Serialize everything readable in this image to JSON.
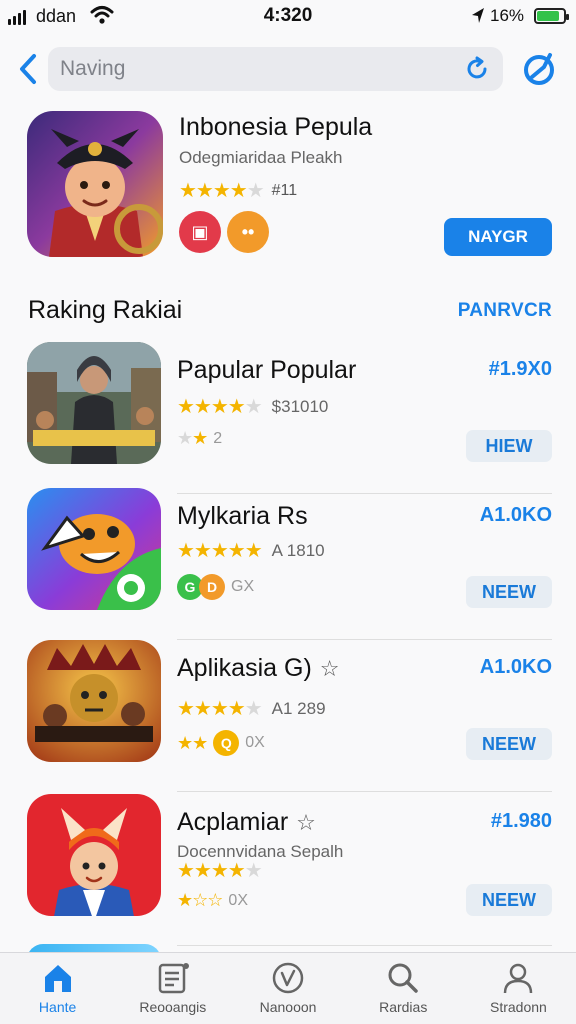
{
  "status_bar": {
    "carrier": "ddan",
    "time": "4:320",
    "battery": "16%",
    "battery_level": 0.85
  },
  "search": {
    "placeholder": "Naving"
  },
  "featured": {
    "title": "Inbonesia Pepula",
    "subtitle": "Odegmiaridaa Pleakh",
    "stars": 4.5,
    "rating_count": "#11",
    "button": "NAYGR",
    "icon": "featured-app-icon"
  },
  "section": {
    "title": "Raking Rakiai",
    "link": "PANRVCR"
  },
  "apps": [
    {
      "name": "Papular Popular",
      "price": "#1.9X0",
      "stars": 4.5,
      "rating_count": "$31010",
      "meta": "2",
      "action": "HIEW",
      "icon": "app-icon-popular"
    },
    {
      "name": "Mylkaria Rs",
      "price": "A1.0KO",
      "stars": 5,
      "rating_count": "A 1810",
      "meta": "GX",
      "action": "NEEW",
      "icon": "app-icon-mylkaria"
    },
    {
      "name": "Aplikasia G)",
      "price": "A1.0KO",
      "stars": 4.5,
      "rating_count": "A1 289",
      "meta": "0X",
      "action": "NEEW",
      "icon": "app-icon-aplikasia"
    },
    {
      "name": "Acplamiar",
      "developer": "Docennvidana Sepalh",
      "price": "#1.980",
      "stars": 4,
      "rating_count": "",
      "meta": "0X",
      "action": "NEEW",
      "icon": "app-icon-acplamiar"
    }
  ],
  "tabs": [
    {
      "label": "Hante",
      "icon": "home-icon",
      "active": true
    },
    {
      "label": "Reooangis",
      "icon": "list-icon",
      "active": false
    },
    {
      "label": "Nanooon",
      "icon": "check-circle-icon",
      "active": false
    },
    {
      "label": "Rardias",
      "icon": "search-icon",
      "active": false
    },
    {
      "label": "Stradonn",
      "icon": "person-icon",
      "active": false
    }
  ],
  "colors": {
    "accent": "#1a82e8",
    "star": "#f4b400",
    "background": "#f9f9fa"
  }
}
